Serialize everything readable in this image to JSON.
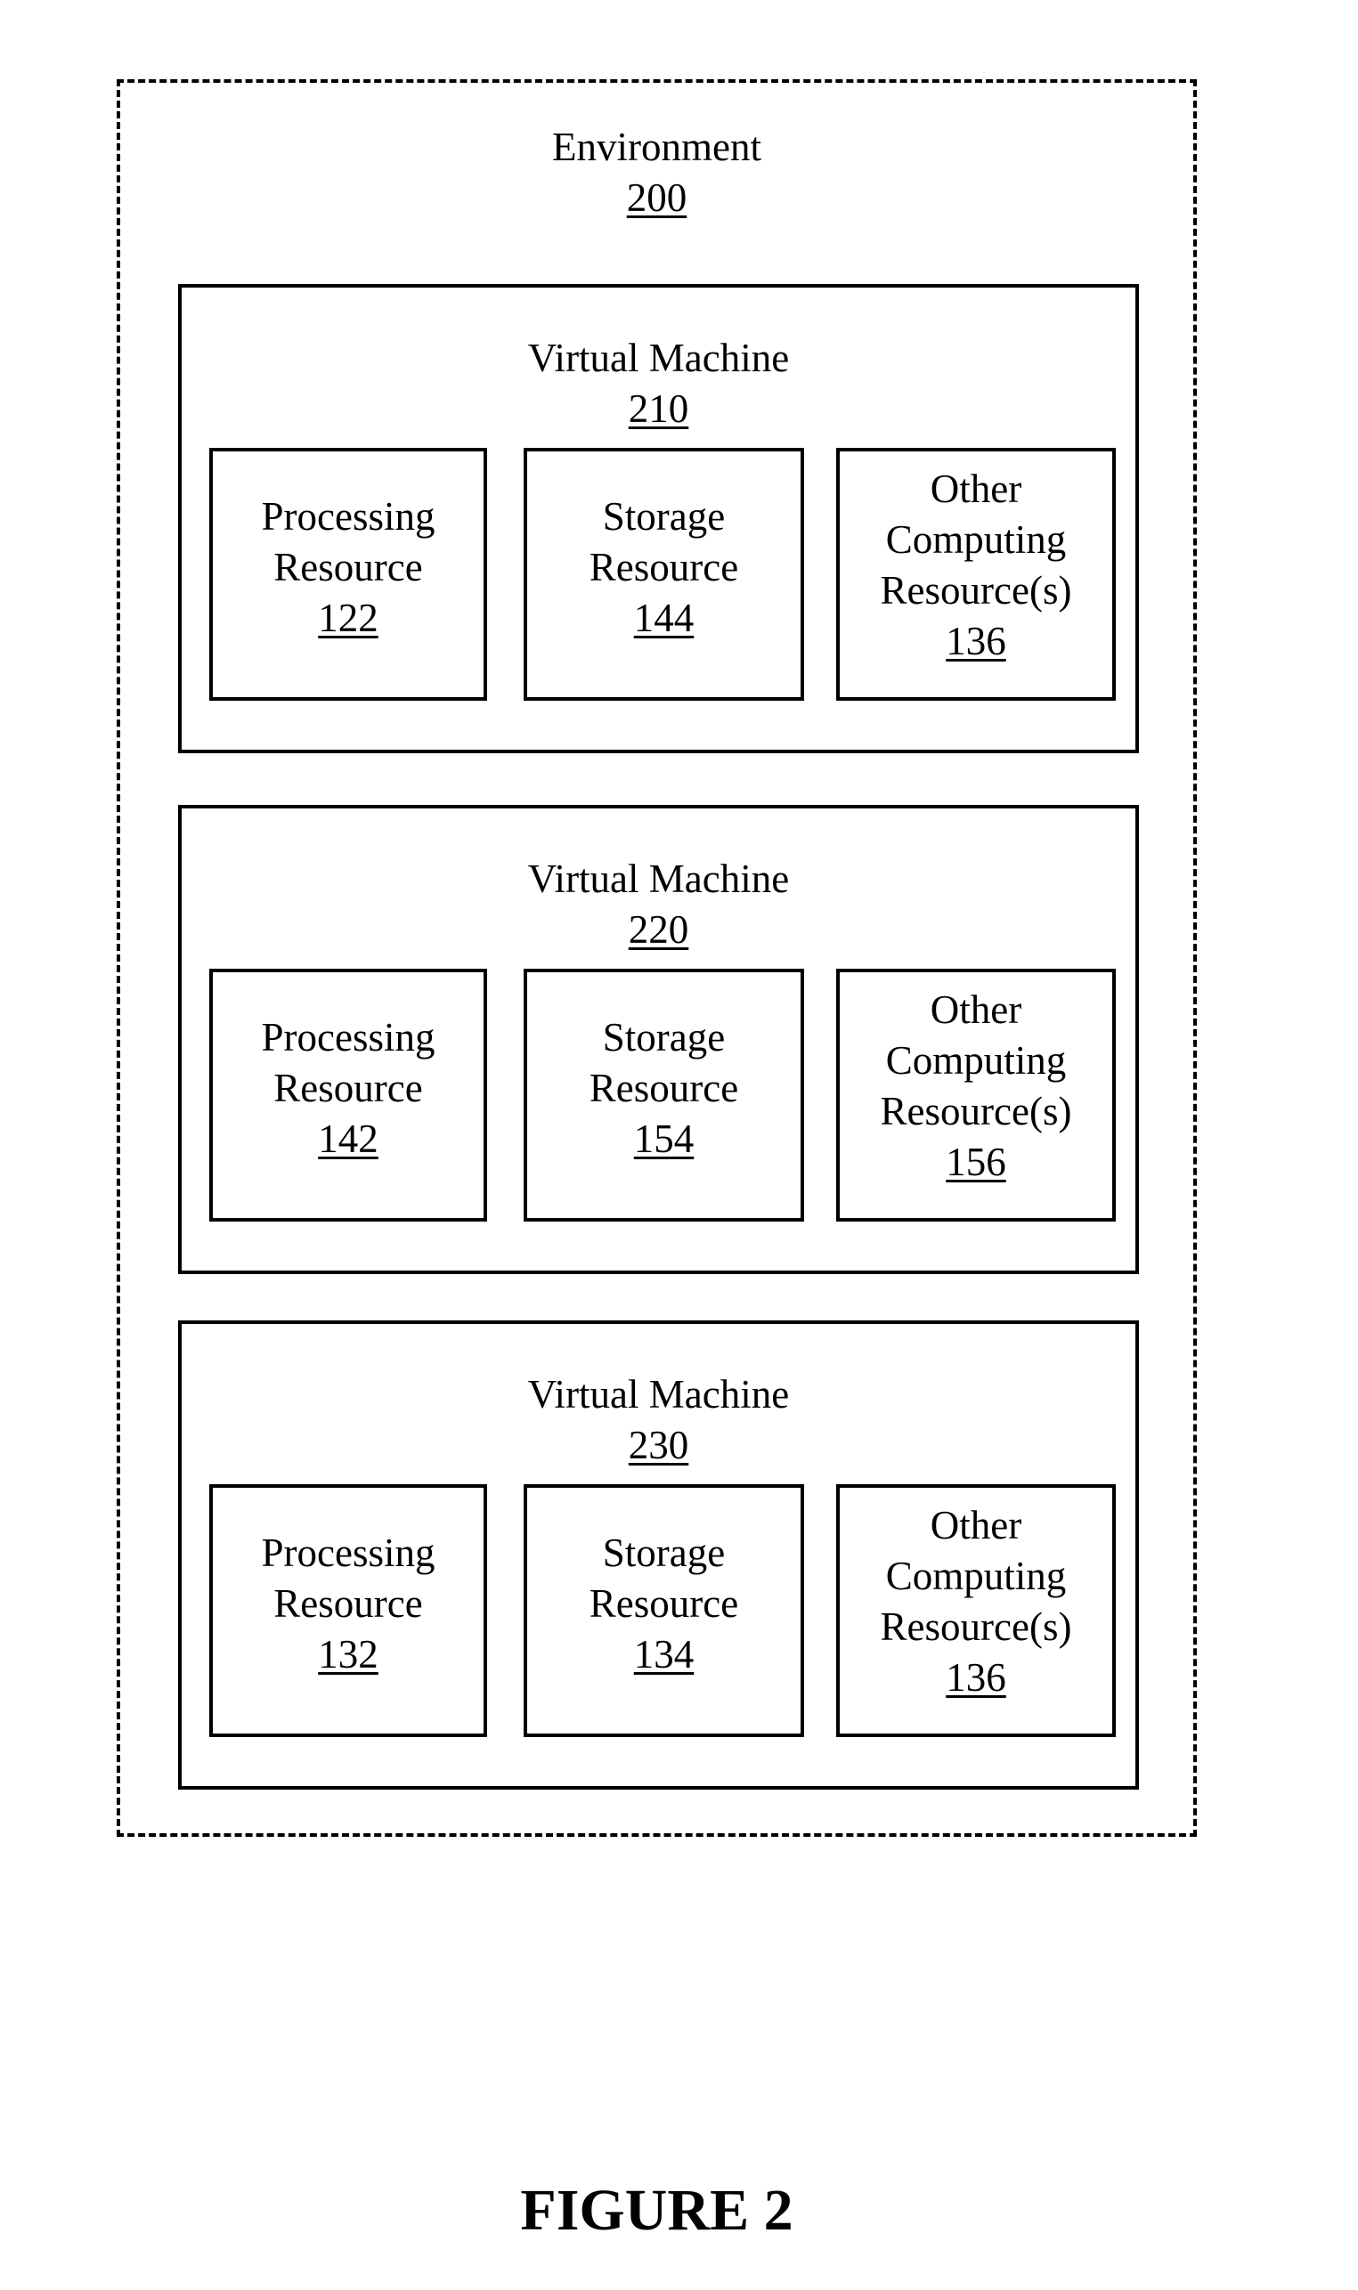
{
  "environment": {
    "title": "Environment",
    "ref": "200"
  },
  "virtual_machines": [
    {
      "title": "Virtual Machine",
      "ref": "210",
      "resources": [
        {
          "lines": [
            "Processing",
            "Resource"
          ],
          "ref": "122"
        },
        {
          "lines": [
            "Storage",
            "Resource"
          ],
          "ref": "144"
        },
        {
          "lines": [
            "Other",
            "Computing",
            "Resource(s)"
          ],
          "ref": "136"
        }
      ]
    },
    {
      "title": "Virtual Machine",
      "ref": "220",
      "resources": [
        {
          "lines": [
            "Processing",
            "Resource"
          ],
          "ref": "142"
        },
        {
          "lines": [
            "Storage",
            "Resource"
          ],
          "ref": "154"
        },
        {
          "lines": [
            "Other",
            "Computing",
            "Resource(s)"
          ],
          "ref": "156"
        }
      ]
    },
    {
      "title": "Virtual Machine",
      "ref": "230",
      "resources": [
        {
          "lines": [
            "Processing",
            "Resource"
          ],
          "ref": "132"
        },
        {
          "lines": [
            "Storage",
            "Resource"
          ],
          "ref": "134"
        },
        {
          "lines": [
            "Other",
            "Computing",
            "Resource(s)"
          ],
          "ref": "136"
        }
      ]
    }
  ],
  "figure_caption": "FIGURE 2"
}
